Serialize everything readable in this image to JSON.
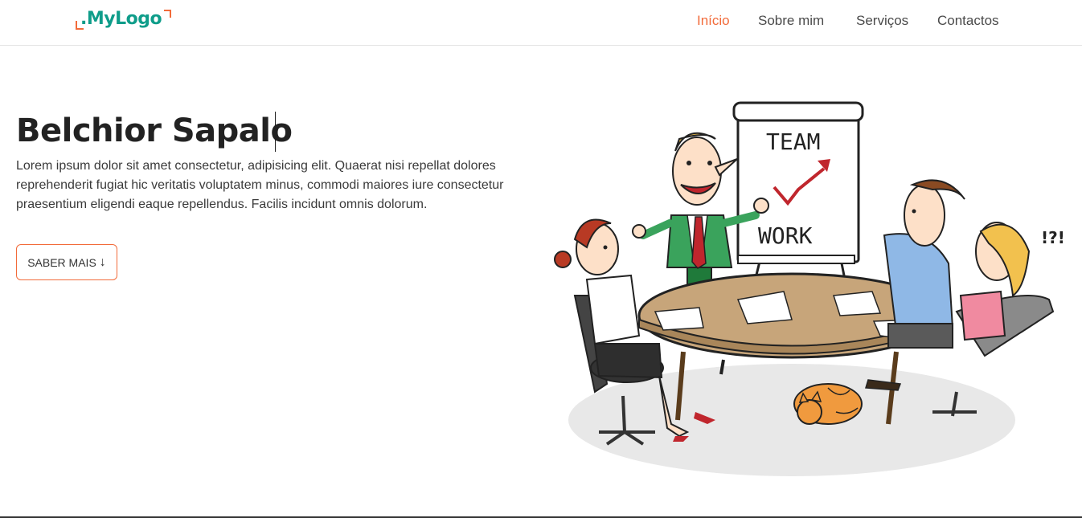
{
  "logo": {
    "text": ".MyLogo"
  },
  "nav": {
    "items": [
      {
        "label": "Início",
        "active": true
      },
      {
        "label": "Sobre mim",
        "active": false
      },
      {
        "label": "Serviços",
        "active": false
      },
      {
        "label": "Contactos",
        "active": false
      }
    ]
  },
  "hero": {
    "title": "Belchior Sapalo",
    "paragraph": "Lorem ipsum dolor sit amet consectetur, adipisicing elit. Quaerat nisi repellat dolores reprehenderit fugiat hic veritatis voluptatem minus, commodi maiores iure consectetur praesentium eligendi eaque repellendus. Facilis incidunt omnis dolorum.",
    "button_label": "SABER MAIS",
    "button_icon": "arrow-down-icon"
  },
  "illustration": {
    "board_line1": "TEAM",
    "board_line2": "WORK",
    "exclaim": "!?!"
  },
  "colors": {
    "accent": "#f26b3a",
    "brand": "#0f9d8a",
    "text": "#222222"
  }
}
